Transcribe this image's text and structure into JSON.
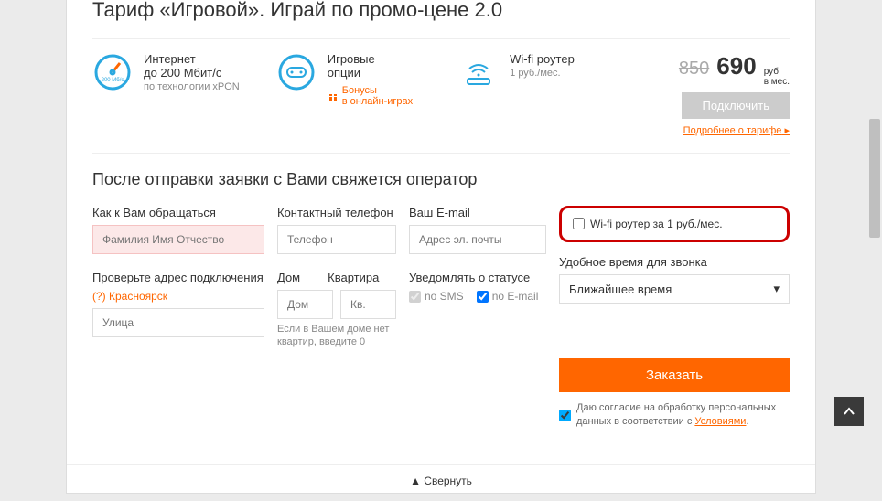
{
  "title": "Тариф «Игровой». Играй по промо-цене 2.0",
  "features": {
    "internet": {
      "t1": "Интернет",
      "t2": "до 200 Мбит/с",
      "t3": "по технологии xPON",
      "speedBadge": "200 Мб/с"
    },
    "gaming": {
      "t1": "Игровые",
      "t2": "опции",
      "bonus": "Бонусы",
      "bonus2": "в онлайн-играх"
    },
    "router": {
      "t1": "Wi-fi роутер",
      "t2": "1 руб./мес."
    }
  },
  "price": {
    "old": "850",
    "new": "690",
    "unit1": "руб",
    "unit2": "в мес."
  },
  "btnConnect": "Подключить",
  "moreLink": "Подробнее о тарифе",
  "formTitle": "После отправки заявки с Вами свяжется оператор",
  "labels": {
    "name": "Как к Вам обращаться",
    "phone": "Контактный телефон",
    "email": "Ваш E-mail",
    "address": "Проверьте адрес подключения",
    "house": "Дом",
    "flat": "Квартира",
    "notify": "Уведомлять о статусе",
    "callTime": "Удобное время для звонка"
  },
  "placeholders": {
    "name": "Фамилия Имя Отчество",
    "phone": "Телефон",
    "email": "Адрес эл. почты",
    "street": "Улица",
    "house": "Дом",
    "flat": "Кв."
  },
  "city": "(?) Красноярск",
  "houseHint": "Если в Вашем доме нет квартир, введите 0",
  "notify": {
    "sms": "no SMS",
    "email": "no E-mail"
  },
  "routerCheckbox": "Wi-fi роутер за 1 руб./мес.",
  "callTimeValue": "Ближайшее время",
  "btnOrder": "Заказать",
  "consent": {
    "text": "Даю согласие на обработку персональных данных в соответствии с ",
    "link": "Условиями"
  },
  "collapse": "Свернуть"
}
